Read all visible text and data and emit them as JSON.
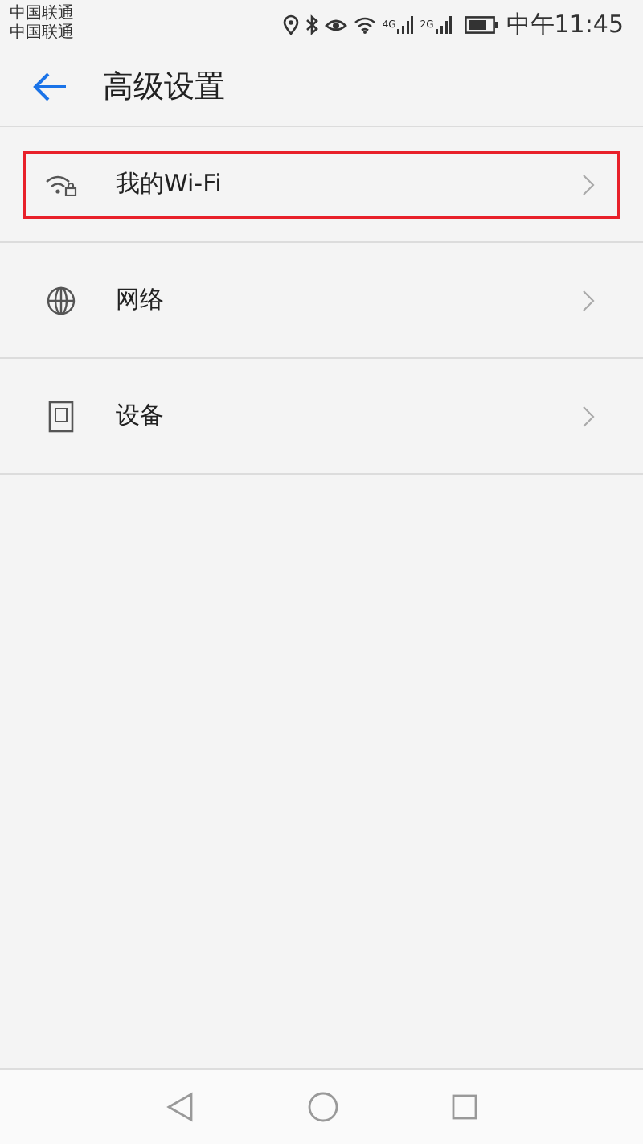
{
  "status_bar": {
    "carriers": [
      "中国联通",
      "中国联通"
    ],
    "network_labels": [
      "4G",
      "2G"
    ],
    "time": "中午11:45"
  },
  "header": {
    "title": "高级设置"
  },
  "items": [
    {
      "kind": "wifi",
      "label": "我的Wi-Fi",
      "highlighted": true
    },
    {
      "kind": "globe",
      "label": "网络",
      "highlighted": false
    },
    {
      "kind": "device",
      "label": "设备",
      "highlighted": false
    }
  ]
}
